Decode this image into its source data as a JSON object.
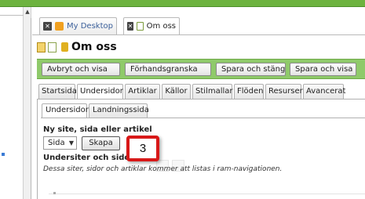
{
  "colors": {
    "topbar": "#6db33f",
    "toolbar": "#8fca6a",
    "callout_border": "#d81818",
    "link": "#3a5f9a"
  },
  "document_tabs": [
    {
      "label": "My Desktop",
      "icon": "desktop-icon",
      "close_icon": "close-icon"
    },
    {
      "label": "Om oss",
      "icon": "page-icon",
      "close_icon": "close-icon"
    }
  ],
  "page": {
    "title": "Om oss",
    "title_icons": [
      "page-edit-icon",
      "page-preview-icon",
      "lock-icon"
    ]
  },
  "toolbar": {
    "cancel_view": "Avbryt och visa",
    "preview": "Förhandsgranska",
    "save_close": "Spara och stäng",
    "save_view": "Spara och visa"
  },
  "main_tabs": [
    "Startsida",
    "Undersidor",
    "Artiklar",
    "Källor",
    "Stilmallar",
    "Flöden",
    "Resurser",
    "Avancerat"
  ],
  "active_main_tab": "Undersidor",
  "inner_tabs": [
    "Undersidor",
    "Landningssida"
  ],
  "active_inner_tab": "Undersidor",
  "create_section": {
    "label": "Ny site, sida eller artikel",
    "select_value": "Sida",
    "create_button": "Skapa"
  },
  "subsites_section": {
    "label": "Undersiter och sido",
    "help_text": "Dessa siter, sidor och artiklar kommer att listas i ram-navigationen."
  },
  "callout": {
    "number": "3"
  }
}
